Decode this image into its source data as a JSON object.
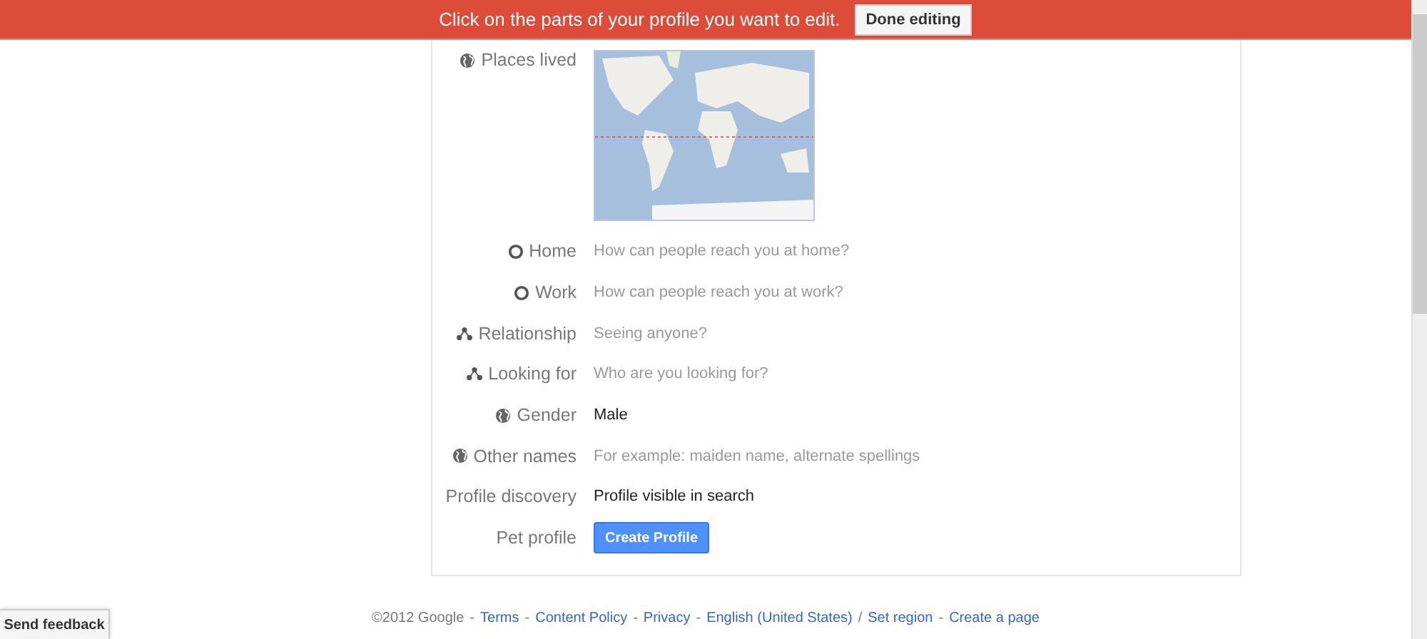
{
  "banner": {
    "message": "Click on the parts of your profile you want to edit.",
    "button": "Done editing"
  },
  "places": {
    "label": "Places lived"
  },
  "rows": [
    {
      "label": "Home",
      "kind": "placeholder",
      "text": "How can people reach you at home?"
    },
    {
      "label": "Work",
      "kind": "placeholder",
      "text": "How can people reach you at work?"
    },
    {
      "label": "Relationship",
      "kind": "placeholder",
      "text": "Seeing anyone?"
    },
    {
      "label": "Looking for",
      "kind": "placeholder",
      "text": "Who are you looking for?"
    },
    {
      "label": "Gender",
      "kind": "value",
      "text": "Male"
    },
    {
      "label": "Other names",
      "kind": "placeholder",
      "text": "For example: maiden name, alternate spellings"
    },
    {
      "label": "Profile discovery",
      "kind": "value",
      "text": "Profile visible in search"
    },
    {
      "label": "Pet profile",
      "kind": "button",
      "text": "Create Profile"
    }
  ],
  "footer": [
    {
      "kind": "text",
      "text": "©2012 Google"
    },
    {
      "kind": "sep",
      "text": "-"
    },
    {
      "kind": "link",
      "text": "Terms"
    },
    {
      "kind": "sep",
      "text": "-"
    },
    {
      "kind": "link",
      "text": "Content Policy"
    },
    {
      "kind": "sep",
      "text": "-"
    },
    {
      "kind": "link",
      "text": "Privacy"
    },
    {
      "kind": "sep",
      "text": "-"
    },
    {
      "kind": "link",
      "text": "English (United States)"
    },
    {
      "kind": "sep",
      "text": "/"
    },
    {
      "kind": "link",
      "text": "Set region"
    },
    {
      "kind": "sep",
      "text": "-"
    },
    {
      "kind": "link",
      "text": "Create a page"
    }
  ],
  "feedback": "Send feedback"
}
